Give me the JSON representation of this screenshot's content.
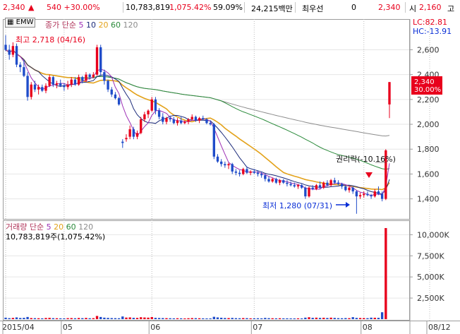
{
  "ticker": {
    "price": "2,340",
    "change": "540 +30.00%",
    "volume": "10,783,819",
    "volume_ratio": "1,075.42%",
    "turnover": "59.09%",
    "amount": "24,215백만",
    "pref_label": "최우선",
    "pref_qty": "0",
    "pref_price": "2,340",
    "open_label": "시",
    "open_value": "2,160",
    "high_label": "고"
  },
  "price_panel": {
    "chip": "EMW",
    "legend": {
      "title": "종가 단순",
      "periods": [
        "5",
        "10",
        "20",
        "60",
        "120"
      ]
    },
    "lc": "LC:82.81",
    "hc": "HC:-13.91",
    "annotation_high": "최고 2,718 (04/16)",
    "annotation_low": "최저 1,280 (07/31)",
    "annotation_rights": "권리락(-10.16%)",
    "current_price_label": "2,340",
    "current_pct_label": "30.00%"
  },
  "volume_panel": {
    "legend": {
      "title": "거래량 단순",
      "periods": [
        "5",
        "20",
        "60",
        "120"
      ]
    },
    "current": "10,783,819주(1,075.42%)"
  },
  "colors": {
    "up": "#e8001c",
    "down": "#1f4cc9",
    "ma5": "#9d2fb5",
    "ma10": "#1b2a7a",
    "ma20": "#e3a21a",
    "ma60": "#2a8a3a",
    "ma120": "#8c8c8c"
  },
  "chart_data": [
    {
      "type": "candlestick",
      "title": "종가 단순",
      "y_ticks": [
        "2,600",
        "2,400",
        "2,200",
        "2,000",
        "1,800",
        "1,600",
        "1,400"
      ],
      "ylim": [
        1250,
        2830
      ],
      "x_ticks": [
        {
          "index": 0,
          "label": "2015/04"
        },
        {
          "index": 16,
          "label": "05"
        },
        {
          "index": 40,
          "label": "06"
        },
        {
          "index": 68,
          "label": "07"
        },
        {
          "index": 98,
          "label": "08"
        },
        {
          "index": 116,
          "label": "08/12"
        }
      ],
      "candles": [
        {
          "o": 2640,
          "h": 2718,
          "l": 2590,
          "c": 2600
        },
        {
          "o": 2600,
          "h": 2640,
          "l": 2520,
          "c": 2560
        },
        {
          "o": 2560,
          "h": 2660,
          "l": 2540,
          "c": 2630
        },
        {
          "o": 2630,
          "h": 2650,
          "l": 2460,
          "c": 2480
        },
        {
          "o": 2480,
          "h": 2500,
          "l": 2420,
          "c": 2460
        },
        {
          "o": 2460,
          "h": 2520,
          "l": 2380,
          "c": 2390
        },
        {
          "o": 2390,
          "h": 2420,
          "l": 2190,
          "c": 2220
        },
        {
          "o": 2220,
          "h": 2340,
          "l": 2200,
          "c": 2320
        },
        {
          "o": 2320,
          "h": 2350,
          "l": 2260,
          "c": 2280
        },
        {
          "o": 2280,
          "h": 2320,
          "l": 2240,
          "c": 2300
        },
        {
          "o": 2300,
          "h": 2320,
          "l": 2260,
          "c": 2270
        },
        {
          "o": 2270,
          "h": 2330,
          "l": 2250,
          "c": 2310
        },
        {
          "o": 2310,
          "h": 2400,
          "l": 2300,
          "c": 2380
        },
        {
          "o": 2380,
          "h": 2390,
          "l": 2300,
          "c": 2320
        },
        {
          "o": 2320,
          "h": 2350,
          "l": 2290,
          "c": 2330
        },
        {
          "o": 2330,
          "h": 2360,
          "l": 2300,
          "c": 2310
        },
        {
          "o": 2310,
          "h": 2330,
          "l": 2270,
          "c": 2300
        },
        {
          "o": 2300,
          "h": 2350,
          "l": 2280,
          "c": 2320
        },
        {
          "o": 2320,
          "h": 2380,
          "l": 2300,
          "c": 2360
        },
        {
          "o": 2360,
          "h": 2380,
          "l": 2310,
          "c": 2320
        },
        {
          "o": 2320,
          "h": 2400,
          "l": 2310,
          "c": 2380
        },
        {
          "o": 2380,
          "h": 2390,
          "l": 2330,
          "c": 2350
        },
        {
          "o": 2350,
          "h": 2420,
          "l": 2340,
          "c": 2400
        },
        {
          "o": 2400,
          "h": 2410,
          "l": 2360,
          "c": 2380
        },
        {
          "o": 2380,
          "h": 2420,
          "l": 2370,
          "c": 2400
        },
        {
          "o": 2400,
          "h": 2640,
          "l": 2390,
          "c": 2620
        },
        {
          "o": 2620,
          "h": 2640,
          "l": 2390,
          "c": 2420
        },
        {
          "o": 2420,
          "h": 2440,
          "l": 2320,
          "c": 2350
        },
        {
          "o": 2350,
          "h": 2360,
          "l": 2260,
          "c": 2280
        },
        {
          "o": 2280,
          "h": 2300,
          "l": 2220,
          "c": 2240
        },
        {
          "o": 2240,
          "h": 2260,
          "l": 2200,
          "c": 2210
        },
        {
          "o": 2210,
          "h": 2220,
          "l": 2150,
          "c": 2160
        },
        {
          "o": 1860,
          "h": 1880,
          "l": 1810,
          "c": 1850
        },
        {
          "o": 1880,
          "h": 1920,
          "l": 1860,
          "c": 1890
        },
        {
          "o": 1900,
          "h": 1990,
          "l": 1880,
          "c": 1960
        },
        {
          "o": 1960,
          "h": 1980,
          "l": 1880,
          "c": 1900
        },
        {
          "o": 1900,
          "h": 1950,
          "l": 1880,
          "c": 1930
        },
        {
          "o": 1930,
          "h": 2060,
          "l": 1920,
          "c": 2040
        },
        {
          "o": 2040,
          "h": 2100,
          "l": 2020,
          "c": 2080
        },
        {
          "o": 2080,
          "h": 2120,
          "l": 2050,
          "c": 2110
        },
        {
          "o": 2110,
          "h": 2220,
          "l": 2100,
          "c": 2200
        },
        {
          "o": 2200,
          "h": 2220,
          "l": 2080,
          "c": 2110
        },
        {
          "o": 2110,
          "h": 2130,
          "l": 2040,
          "c": 2060
        },
        {
          "o": 2060,
          "h": 2090,
          "l": 2000,
          "c": 2020
        },
        {
          "o": 2020,
          "h": 2060,
          "l": 2000,
          "c": 2050
        },
        {
          "o": 2050,
          "h": 2070,
          "l": 2020,
          "c": 2040
        },
        {
          "o": 2040,
          "h": 2060,
          "l": 2000,
          "c": 2010
        },
        {
          "o": 2010,
          "h": 2050,
          "l": 1990,
          "c": 2030
        },
        {
          "o": 2030,
          "h": 2060,
          "l": 2000,
          "c": 2010
        },
        {
          "o": 2010,
          "h": 2030,
          "l": 2000,
          "c": 2020
        },
        {
          "o": 2020,
          "h": 2050,
          "l": 2000,
          "c": 2040
        },
        {
          "o": 2040,
          "h": 2080,
          "l": 2030,
          "c": 2060
        },
        {
          "o": 2060,
          "h": 2070,
          "l": 2020,
          "c": 2030
        },
        {
          "o": 2030,
          "h": 2060,
          "l": 2010,
          "c": 2050
        },
        {
          "o": 2050,
          "h": 2070,
          "l": 2030,
          "c": 2040
        },
        {
          "o": 2040,
          "h": 2050,
          "l": 2000,
          "c": 2010
        },
        {
          "o": 2010,
          "h": 2030,
          "l": 1990,
          "c": 2000
        },
        {
          "o": 2000,
          "h": 2010,
          "l": 1720,
          "c": 1740
        },
        {
          "o": 1740,
          "h": 1760,
          "l": 1690,
          "c": 1700
        },
        {
          "o": 1700,
          "h": 1720,
          "l": 1660,
          "c": 1680
        },
        {
          "o": 1680,
          "h": 1700,
          "l": 1650,
          "c": 1670
        },
        {
          "o": 1670,
          "h": 1690,
          "l": 1640,
          "c": 1680
        },
        {
          "o": 1680,
          "h": 1690,
          "l": 1600,
          "c": 1620
        },
        {
          "o": 1620,
          "h": 1640,
          "l": 1590,
          "c": 1610
        },
        {
          "o": 1610,
          "h": 1630,
          "l": 1580,
          "c": 1600
        },
        {
          "o": 1600,
          "h": 1650,
          "l": 1590,
          "c": 1640
        },
        {
          "o": 1640,
          "h": 1660,
          "l": 1600,
          "c": 1610
        },
        {
          "o": 1610,
          "h": 1630,
          "l": 1590,
          "c": 1620
        },
        {
          "o": 1620,
          "h": 1640,
          "l": 1600,
          "c": 1610
        },
        {
          "o": 1610,
          "h": 1630,
          "l": 1580,
          "c": 1600
        },
        {
          "o": 1600,
          "h": 1620,
          "l": 1570,
          "c": 1590
        },
        {
          "o": 1590,
          "h": 1600,
          "l": 1540,
          "c": 1560
        },
        {
          "o": 1560,
          "h": 1580,
          "l": 1530,
          "c": 1540
        },
        {
          "o": 1540,
          "h": 1570,
          "l": 1530,
          "c": 1560
        },
        {
          "o": 1560,
          "h": 1570,
          "l": 1520,
          "c": 1530
        },
        {
          "o": 1530,
          "h": 1560,
          "l": 1510,
          "c": 1550
        },
        {
          "o": 1550,
          "h": 1560,
          "l": 1520,
          "c": 1530
        },
        {
          "o": 1530,
          "h": 1550,
          "l": 1500,
          "c": 1520
        },
        {
          "o": 1520,
          "h": 1540,
          "l": 1500,
          "c": 1510
        },
        {
          "o": 1510,
          "h": 1530,
          "l": 1490,
          "c": 1500
        },
        {
          "o": 1500,
          "h": 1520,
          "l": 1480,
          "c": 1510
        },
        {
          "o": 1510,
          "h": 1520,
          "l": 1480,
          "c": 1490
        },
        {
          "o": 1490,
          "h": 1500,
          "l": 1400,
          "c": 1420
        },
        {
          "o": 1420,
          "h": 1500,
          "l": 1410,
          "c": 1490
        },
        {
          "o": 1490,
          "h": 1510,
          "l": 1470,
          "c": 1480
        },
        {
          "o": 1480,
          "h": 1520,
          "l": 1470,
          "c": 1510
        },
        {
          "o": 1510,
          "h": 1540,
          "l": 1480,
          "c": 1490
        },
        {
          "o": 1490,
          "h": 1540,
          "l": 1480,
          "c": 1530
        },
        {
          "o": 1530,
          "h": 1550,
          "l": 1500,
          "c": 1510
        },
        {
          "o": 1510,
          "h": 1560,
          "l": 1500,
          "c": 1550
        },
        {
          "o": 1550,
          "h": 1570,
          "l": 1520,
          "c": 1530
        },
        {
          "o": 1530,
          "h": 1550,
          "l": 1510,
          "c": 1520
        },
        {
          "o": 1520,
          "h": 1530,
          "l": 1480,
          "c": 1500
        },
        {
          "o": 1500,
          "h": 1510,
          "l": 1460,
          "c": 1470
        },
        {
          "o": 1470,
          "h": 1500,
          "l": 1450,
          "c": 1490
        },
        {
          "o": 1490,
          "h": 1500,
          "l": 1440,
          "c": 1460
        },
        {
          "o": 1460,
          "h": 1470,
          "l": 1280,
          "c": 1420
        },
        {
          "o": 1420,
          "h": 1450,
          "l": 1400,
          "c": 1430
        },
        {
          "o": 1430,
          "h": 1460,
          "l": 1410,
          "c": 1440
        },
        {
          "o": 1440,
          "h": 1460,
          "l": 1420,
          "c": 1430
        },
        {
          "o": 1430,
          "h": 1440,
          "l": 1400,
          "c": 1420
        },
        {
          "o": 1420,
          "h": 1480,
          "l": 1410,
          "c": 1460
        },
        {
          "o": 1460,
          "h": 1500,
          "l": 1430,
          "c": 1440
        },
        {
          "o": 1440,
          "h": 1460,
          "l": 1380,
          "c": 1400
        },
        {
          "o": 1400,
          "h": 1800,
          "l": 1390,
          "c": 1790
        },
        {
          "o": 2160,
          "h": 2340,
          "l": 2050,
          "c": 2340
        }
      ]
    },
    {
      "type": "bar",
      "title": "거래량 단순",
      "y_ticks": [
        "10,000K",
        "7,500K",
        "5,000K",
        "2,500K"
      ],
      "ylim": [
        0,
        11200
      ],
      "unit": "K",
      "values": [
        180,
        120,
        150,
        210,
        140,
        160,
        260,
        130,
        120,
        110,
        100,
        140,
        160,
        120,
        110,
        100,
        90,
        120,
        130,
        110,
        140,
        120,
        150,
        110,
        120,
        380,
        260,
        180,
        150,
        130,
        120,
        110,
        320,
        190,
        210,
        160,
        150,
        230,
        200,
        180,
        250,
        160,
        140,
        130,
        120,
        110,
        100,
        110,
        100,
        90,
        110,
        130,
        120,
        110,
        100,
        90,
        90,
        280,
        210,
        170,
        140,
        130,
        150,
        120,
        110,
        130,
        120,
        100,
        100,
        110,
        100,
        150,
        120,
        110,
        100,
        110,
        100,
        100,
        90,
        90,
        100,
        90,
        180,
        230,
        160,
        180,
        150,
        170,
        140,
        180,
        150,
        120,
        110,
        130,
        120,
        240,
        150,
        140,
        130,
        120,
        180,
        170,
        160,
        820,
        10784
      ],
      "up": [
        false,
        false,
        true,
        false,
        false,
        false,
        false,
        true,
        false,
        true,
        false,
        true,
        true,
        false,
        true,
        false,
        false,
        true,
        true,
        false,
        true,
        false,
        true,
        false,
        true,
        true,
        false,
        false,
        false,
        false,
        false,
        false,
        false,
        true,
        true,
        false,
        true,
        true,
        true,
        true,
        true,
        false,
        false,
        false,
        true,
        false,
        false,
        true,
        false,
        true,
        true,
        true,
        false,
        true,
        false,
        false,
        false,
        false,
        false,
        false,
        false,
        true,
        false,
        false,
        false,
        true,
        false,
        true,
        false,
        false,
        false,
        false,
        false,
        true,
        false,
        true,
        false,
        false,
        false,
        false,
        true,
        false,
        false,
        true,
        false,
        true,
        false,
        true,
        false,
        true,
        false,
        false,
        false,
        false,
        true,
        false,
        false,
        true,
        true,
        false,
        false,
        true,
        false,
        false,
        true,
        true
      ]
    }
  ]
}
